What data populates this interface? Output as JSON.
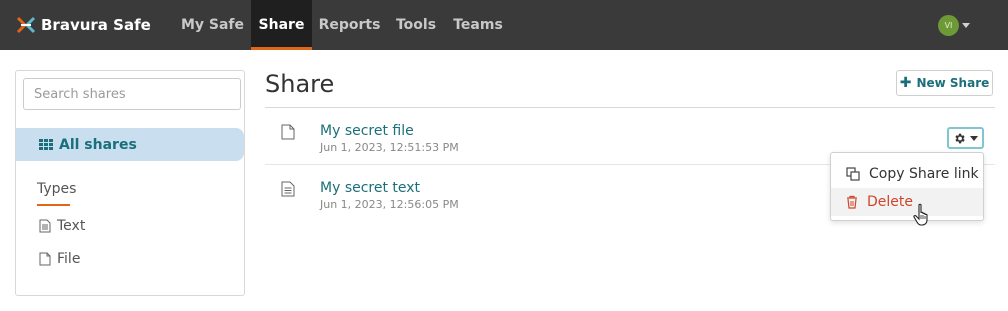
{
  "app": {
    "brand_name": "Bravura Safe",
    "nav": [
      {
        "label": "My Safe"
      },
      {
        "label": "Share",
        "active": true
      },
      {
        "label": "Reports"
      },
      {
        "label": "Tools"
      },
      {
        "label": "Teams"
      }
    ],
    "user_initials": "VI",
    "colors": {
      "navbar": "#3a3a3a",
      "accent": "#e0661a",
      "link": "#1b6f7a",
      "danger": "#d0452a",
      "avatar": "#6d9a36"
    }
  },
  "sidebar": {
    "search_placeholder": "Search shares",
    "all_shares_label": "All shares",
    "types_heading": "Types",
    "types": [
      {
        "label": "Text",
        "icon": "text-file-icon"
      },
      {
        "label": "File",
        "icon": "file-icon"
      }
    ]
  },
  "main": {
    "title": "Share",
    "new_share_label": "New Share",
    "shares": [
      {
        "name": "My secret file",
        "date": "Jun 1, 2023, 12:51:53 PM",
        "icon": "file-icon"
      },
      {
        "name": "My secret text",
        "date": "Jun 1, 2023, 12:56:05 PM",
        "icon": "text-file-icon"
      }
    ],
    "options_menu": {
      "items": [
        {
          "label": "Copy Share link",
          "icon": "copy-icon"
        },
        {
          "label": "Delete",
          "icon": "trash-icon",
          "hovered": true
        }
      ]
    }
  }
}
